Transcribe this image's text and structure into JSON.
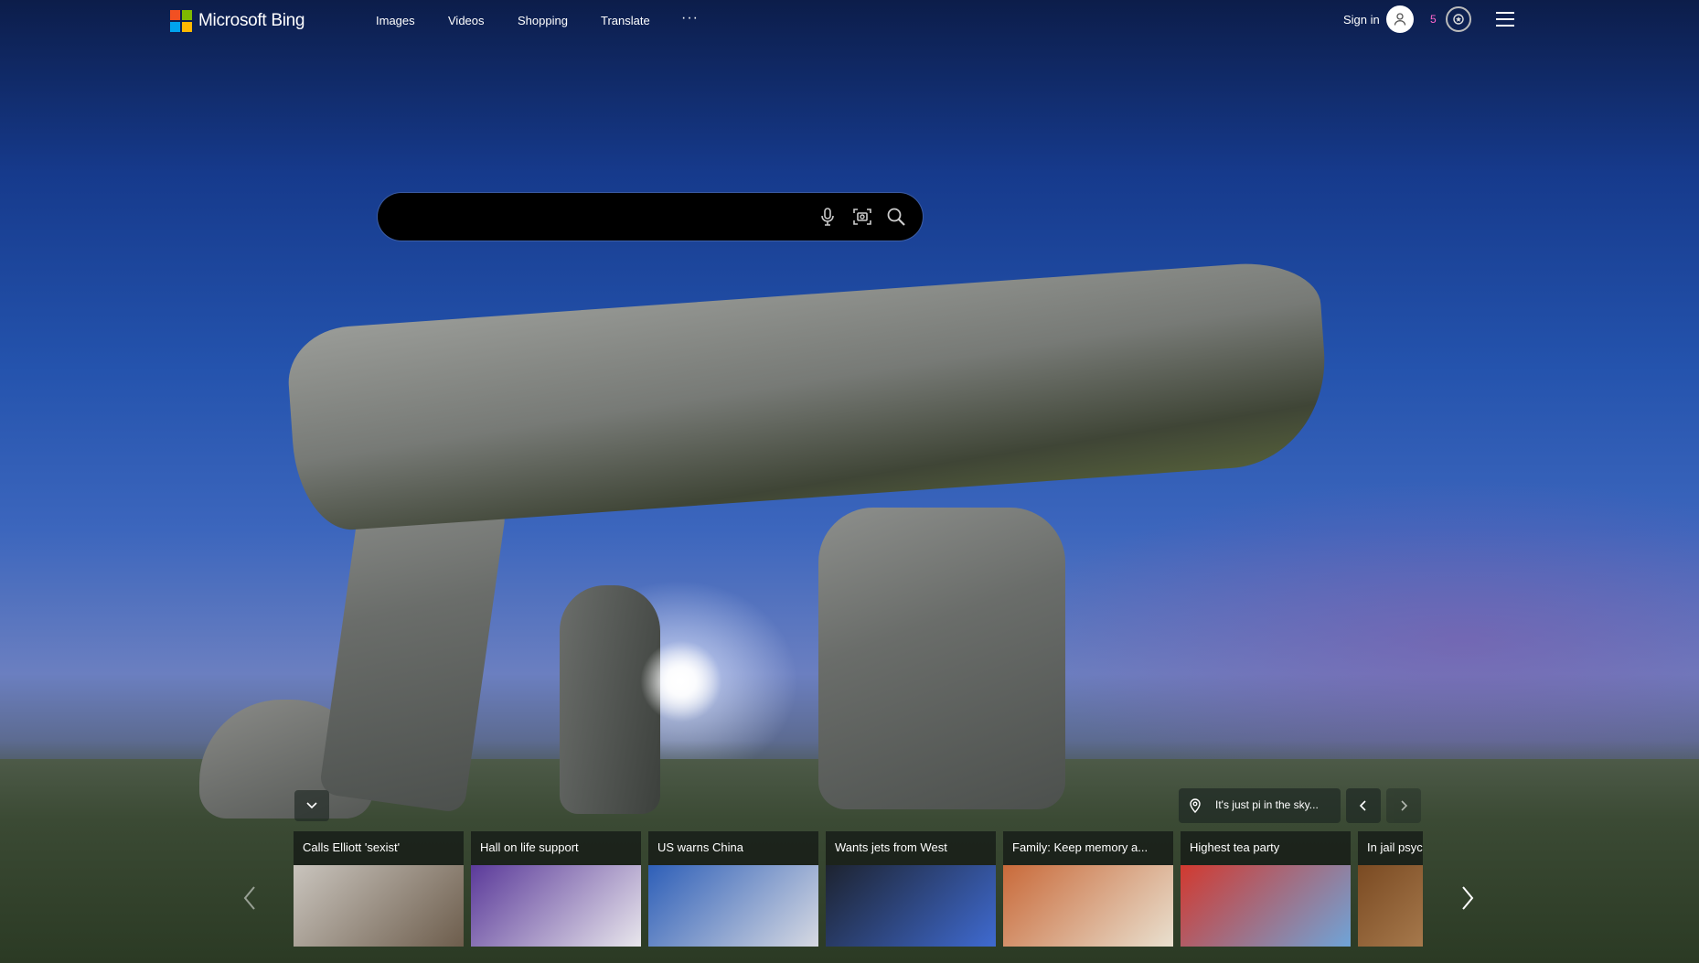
{
  "brand": {
    "name": "Microsoft Bing"
  },
  "nav": {
    "images": "Images",
    "videos": "Videos",
    "shopping": "Shopping",
    "translate": "Translate",
    "more": "···"
  },
  "account": {
    "signin": "Sign in",
    "rewards_count": "5"
  },
  "search": {
    "placeholder": "",
    "value": ""
  },
  "location": {
    "text": "It's just pi in the sky..."
  },
  "cards": [
    {
      "title": "Calls Elliott 'sexist'",
      "color_a": "#c9c4bd",
      "color_b": "#6d5d4c"
    },
    {
      "title": "Hall on life support",
      "color_a": "#5b3a9a",
      "color_b": "#e8e6ec"
    },
    {
      "title": "US warns China",
      "color_a": "#2e5fb8",
      "color_b": "#d6d9e2"
    },
    {
      "title": "Wants jets from West",
      "color_a": "#1d2330",
      "color_b": "#3f6ad0"
    },
    {
      "title": "Family: Keep memory a...",
      "color_a": "#c96a3a",
      "color_b": "#e9e0cf"
    },
    {
      "title": "Highest tea party",
      "color_a": "#d2392f",
      "color_b": "#6fa4d8"
    },
    {
      "title": "In jail psych...",
      "color_a": "#7a4a22",
      "color_b": "#c59a6a"
    }
  ]
}
